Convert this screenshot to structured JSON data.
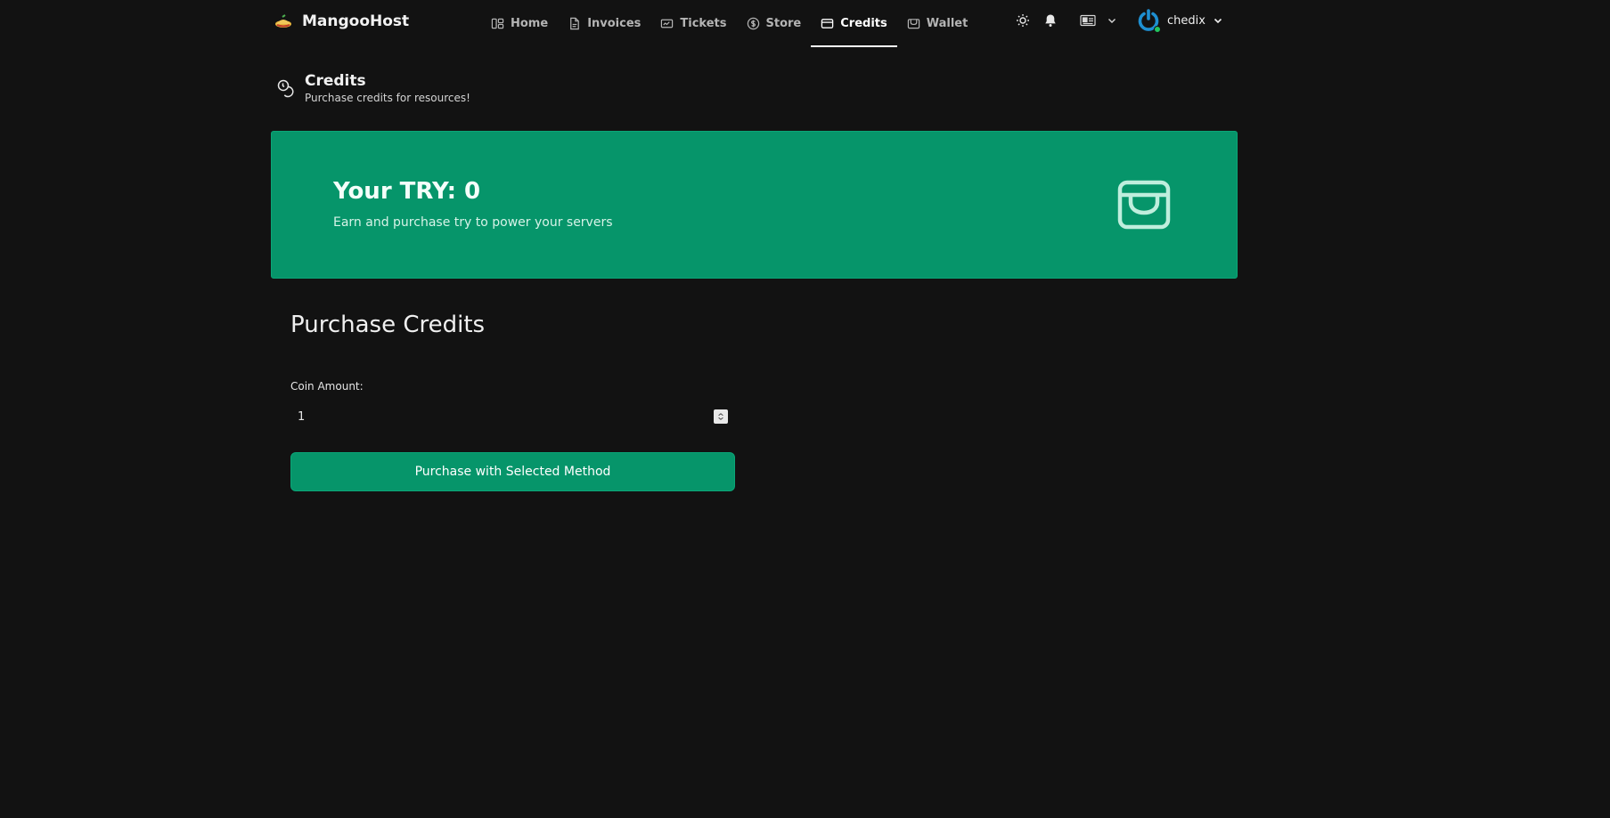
{
  "brand": {
    "name": "MangooHost"
  },
  "nav": [
    {
      "label": "Home",
      "icon": "home-icon"
    },
    {
      "label": "Invoices",
      "icon": "document-icon"
    },
    {
      "label": "Tickets",
      "icon": "ticket-icon"
    },
    {
      "label": "Store",
      "icon": "dollar-icon"
    },
    {
      "label": "Credits",
      "icon": "credit-card-icon",
      "active": true
    },
    {
      "label": "Wallet",
      "icon": "wallet-icon"
    }
  ],
  "user": {
    "name": "chedix",
    "status": "online"
  },
  "page": {
    "title": "Credits",
    "subtitle": "Purchase credits for resources!"
  },
  "banner": {
    "title": "Your TRY: 0",
    "subtitle": "Earn and purchase try to power your servers",
    "color": "#06956a"
  },
  "purchase": {
    "section_title": "Purchase Credits",
    "coin_label": "Coin Amount:",
    "coin_value": "1",
    "button_label": "Purchase with Selected Method"
  },
  "colors": {
    "background": "#121212",
    "accent": "#06956a"
  }
}
